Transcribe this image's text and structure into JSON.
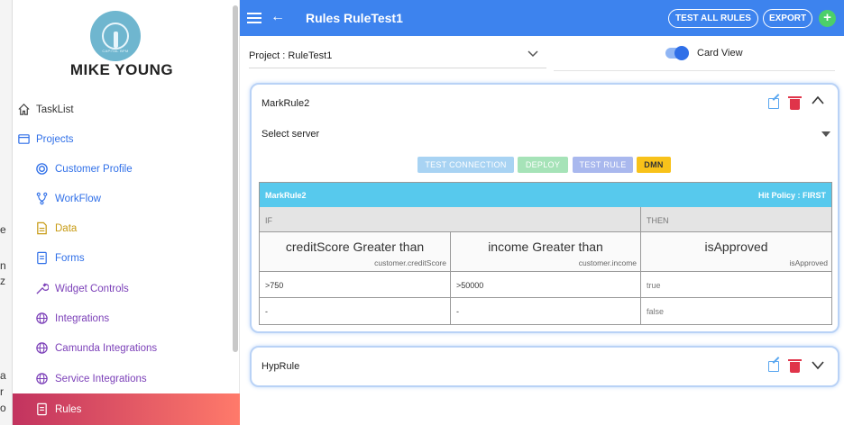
{
  "app": {
    "title": "Rules RuleTest1",
    "accent": "#3d83ee"
  },
  "user": {
    "name": "MIKE YOUNG",
    "logo_text": "CAPITAL BPM"
  },
  "sidebar": {
    "items": [
      {
        "label": "TaskList",
        "icon": "home-icon",
        "color": "#333333"
      },
      {
        "label": "Projects",
        "icon": "folder-icon",
        "color": "#2f6fe8"
      },
      {
        "label": "Customer Profile",
        "icon": "target-icon",
        "color": "#2f6fe8"
      },
      {
        "label": "WorkFlow",
        "icon": "workflow-icon",
        "color": "#2f6fe8"
      },
      {
        "label": "Data",
        "icon": "file-icon",
        "color": "#c79a12"
      },
      {
        "label": "Forms",
        "icon": "form-icon",
        "color": "#2f6fe8"
      },
      {
        "label": "Widget Controls",
        "icon": "wrench-icon",
        "color": "#7b3fb8"
      },
      {
        "label": "Integrations",
        "icon": "globe-icon",
        "color": "#7b3fb8"
      },
      {
        "label": "Camunda Integrations",
        "icon": "globe-icon",
        "color": "#7b3fb8"
      },
      {
        "label": "Service Integrations",
        "icon": "globe-icon",
        "color": "#7b3fb8"
      },
      {
        "label": "Rules",
        "icon": "form-icon",
        "color": "#ffffff"
      }
    ]
  },
  "topbar": {
    "test_all_label": "TEST ALL RULES",
    "export_label": "EXPORT",
    "add_symbol": "+"
  },
  "project": {
    "selected": "Project : RuleTest1",
    "card_view_label": "Card View",
    "card_view_on": true
  },
  "rules": [
    {
      "name": "MarkRule2",
      "server_placeholder": "Select server",
      "buttons": {
        "test_connection": "TEST CONNECTION",
        "deploy": "DEPLOY",
        "test_rule": "TEST RULE",
        "dmn": "DMN"
      },
      "table": {
        "name": "MarkRule2",
        "hit_policy": "Hit Policy : FIRST",
        "if_label": "IF",
        "then_label": "THEN",
        "columns": [
          {
            "title": "creditScore Greater than",
            "expr": "customer.creditScore"
          },
          {
            "title": "income Greater than",
            "expr": "customer.income"
          },
          {
            "title": "isApproved",
            "expr": "isApproved"
          }
        ],
        "rows": [
          [
            ">750",
            ">50000",
            "true"
          ],
          [
            "-",
            "-",
            "false"
          ]
        ]
      }
    },
    {
      "name": "HypRule"
    }
  ],
  "background": {
    "fragments": [
      "e",
      "n",
      "z",
      "a",
      "r",
      "o"
    ]
  }
}
